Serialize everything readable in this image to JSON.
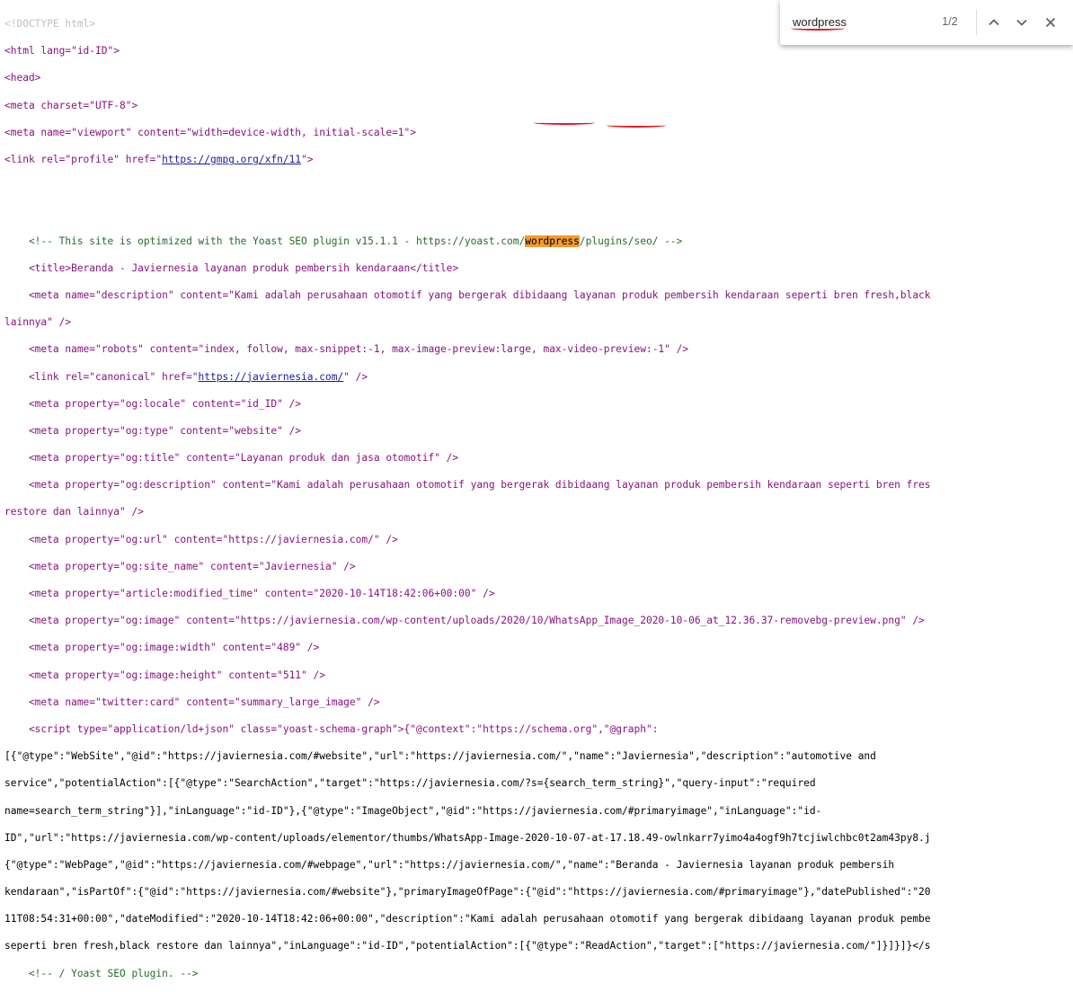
{
  "find_bar": {
    "query": "wordpress",
    "match_count": "1/2",
    "prev_icon": "chevron-up-icon",
    "next_icon": "chevron-down-icon",
    "close_icon": "close-icon"
  },
  "colors": {
    "tag": "#881280",
    "attr_name": "#994500",
    "attr_value": "#1a1aa6",
    "comment": "#236e25",
    "highlight": "#f29b30",
    "annotation": "#e8131a"
  },
  "source": {
    "l1": "<!DOCTYPE html>",
    "l2": "<html lang=\"id-ID\">",
    "l3": "<head>",
    "l4": "<meta charset=\"UTF-8\">",
    "l5": "<meta name=\"viewport\" content=\"width=device-width, initial-scale=1\">",
    "l6a": "<link rel=\"profile\" href=\"",
    "l6_link": "https://gmpg.org/xfn/11",
    "l6b": "\">",
    "l9a": "    <!-- This site is optimized with the Yoast SEO plugin v15.1.1 - https://yoast.com/",
    "l9_hl": "wordpress",
    "l9b": "/plugins/seo/ -->",
    "l10": "    <title>Beranda - Javiernesia layanan produk pembersih kendaraan</title>",
    "l11": "    <meta name=\"description\" content=\"Kami adalah perusahaan otomotif yang bergerak dibidaang layanan produk pembersih kendaraan seperti bren fresh,black",
    "l12": "lainnya\" />",
    "l13": "    <meta name=\"robots\" content=\"index, follow, max-snippet:-1, max-image-preview:large, max-video-preview:-1\" />",
    "l14a": "    <link rel=\"canonical\" href=\"",
    "l14_link": "https://javiernesia.com/",
    "l14b": "\" />",
    "l15": "    <meta property=\"og:locale\" content=\"id_ID\" />",
    "l16": "    <meta property=\"og:type\" content=\"website\" />",
    "l17": "    <meta property=\"og:title\" content=\"Layanan produk dan jasa otomotif\" />",
    "l18": "    <meta property=\"og:description\" content=\"Kami adalah perusahaan otomotif yang bergerak dibidaang layanan produk pembersih kendaraan seperti bren fres",
    "l19": "restore dan lainnya\" />",
    "l20": "    <meta property=\"og:url\" content=\"https://javiernesia.com/\" />",
    "l21": "    <meta property=\"og:site_name\" content=\"Javiernesia\" />",
    "l22": "    <meta property=\"article:modified_time\" content=\"2020-10-14T18:42:06+00:00\" />",
    "l23": "    <meta property=\"og:image\" content=\"https://javiernesia.com/wp-content/uploads/2020/10/WhatsApp_Image_2020-10-06_at_12.36.37-removebg-preview.png\" />",
    "l24": "    <meta property=\"og:image:width\" content=\"489\" />",
    "l25": "    <meta property=\"og:image:height\" content=\"511\" />",
    "l26": "    <meta name=\"twitter:card\" content=\"summary_large_image\" />",
    "l27": "    <script type=\"application/ld+json\" class=\"yoast-schema-graph\">{\"@context\":\"https://schema.org\",\"@graph\":",
    "l28": "[{\"@type\":\"WebSite\",\"@id\":\"https://javiernesia.com/#website\",\"url\":\"https://javiernesia.com/\",\"name\":\"Javiernesia\",\"description\":\"automotive and",
    "l29": "service\",\"potentialAction\":[{\"@type\":\"SearchAction\",\"target\":\"https://javiernesia.com/?s={search_term_string}\",\"query-input\":\"required",
    "l30": "name=search_term_string\"}],\"inLanguage\":\"id-ID\"},{\"@type\":\"ImageObject\",\"@id\":\"https://javiernesia.com/#primaryimage\",\"inLanguage\":\"id-",
    "l31": "ID\",\"url\":\"https://javiernesia.com/wp-content/uploads/elementor/thumbs/WhatsApp-Image-2020-10-07-at-17.18.49-owlnkarr7yimo4a4ogf9h7tcjiwlchbc0t2am43py8.j",
    "l32": "{\"@type\":\"WebPage\",\"@id\":\"https://javiernesia.com/#webpage\",\"url\":\"https://javiernesia.com/\",\"name\":\"Beranda - Javiernesia layanan produk pembersih",
    "l33": "kendaraan\",\"isPartOf\":{\"@id\":\"https://javiernesia.com/#website\"},\"primaryImageOfPage\":{\"@id\":\"https://javiernesia.com/#primaryimage\"},\"datePublished\":\"20",
    "l34": "11T08:54:31+00:00\",\"dateModified\":\"2020-10-14T18:42:06+00:00\",\"description\":\"Kami adalah perusahaan otomotif yang bergerak dibidaang layanan produk pembe",
    "l35": "seperti bren fresh,black restore dan lainnya\",\"inLanguage\":\"id-ID\",\"potentialAction\":[{\"@type\":\"ReadAction\",\"target\":[\"https://javiernesia.com/\"]}]}]}</s",
    "l36": "    <!-- / Yoast SEO plugin. -->"
  }
}
